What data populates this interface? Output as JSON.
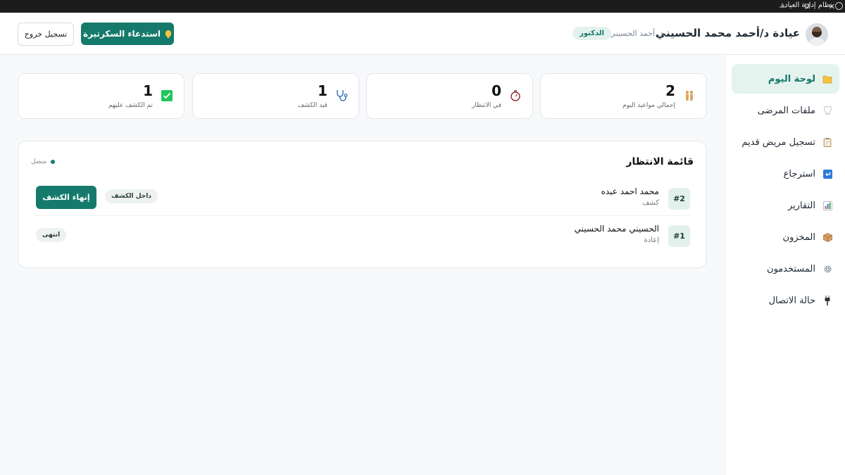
{
  "window": {
    "title": "نظام إدارة العيادة",
    "controls": [
      "minimize-icon",
      "restore-icon",
      "close-icon"
    ]
  },
  "header": {
    "clinic_title": "عيادة د/أحمد محمد الحسيني",
    "doctor_name": "د. أحمد الحسيني",
    "role_badge": "الدكتور",
    "call_button": "استدعاء السكرتيرة",
    "logout_button": "تسجيل خروج"
  },
  "sidebar": {
    "items": [
      {
        "label": "لوحة اليوم",
        "icon": "folder-icon",
        "active": true
      },
      {
        "label": "ملفات المرضى",
        "icon": "tooth-icon",
        "active": false
      },
      {
        "label": "تسجيل مريض قديم",
        "icon": "clipboard-icon",
        "active": false
      },
      {
        "label": "استرجاع",
        "icon": "return-icon",
        "active": false
      },
      {
        "label": "التقارير",
        "icon": "bar-chart-icon",
        "active": false
      },
      {
        "label": "المخزون",
        "icon": "package-icon",
        "active": false
      },
      {
        "label": "المستخدمون",
        "icon": "gear-icon",
        "active": false
      },
      {
        "label": "حالة الاتصال",
        "icon": "plug-icon",
        "active": false
      }
    ]
  },
  "stats": [
    {
      "value": "2",
      "label": "إجمالي مواعيد اليوم",
      "icon": "people-icon"
    },
    {
      "value": "0",
      "label": "في الانتظار",
      "icon": "stopwatch-icon"
    },
    {
      "value": "1",
      "label": "قيد الكشف",
      "icon": "stethoscope-icon"
    },
    {
      "value": "1",
      "label": "تم الكشف عليهم",
      "icon": "check-icon"
    }
  ],
  "waiting_list": {
    "title": "قائمة الانتظار",
    "connection_status": "متصل",
    "rows": [
      {
        "number": "#2",
        "name": "محمد احمد عبده",
        "type": "كشف",
        "status": "داخل الكشف",
        "action": "إنهاء الكشف"
      },
      {
        "number": "#1",
        "name": "الحسيني محمد الحسيني",
        "type": "إعادة",
        "status": "انتهى"
      }
    ]
  },
  "colors": {
    "accent": "#157a6c",
    "accent_light": "#e5f3ef",
    "check_green": "#22c55e"
  }
}
